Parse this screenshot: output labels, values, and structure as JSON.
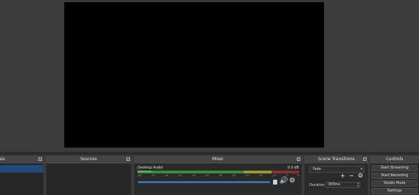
{
  "docks": {
    "scenes": {
      "title": "es"
    },
    "sources": {
      "title": "Sources"
    },
    "mixer": {
      "title": "Mixer",
      "channel": {
        "name": "Desktop Audio",
        "level": "0.0 dB"
      },
      "ticks": [
        "-60",
        "-55",
        "-50",
        "-45",
        "-40",
        "-35",
        "-30",
        "-25",
        "-20",
        "-15",
        "-10",
        "-5",
        "0"
      ]
    },
    "transitions": {
      "title": "Scene Transitions",
      "selected": "Fade",
      "duration_label": "Duration",
      "duration_value": "300ms"
    },
    "controls": {
      "title": "Controls",
      "buttons": [
        "Start Streaming",
        "Start Recording",
        "Studio Mode",
        "Settings"
      ]
    }
  },
  "icons": {
    "float": "float-icon",
    "add": "add-icon",
    "remove": "remove-icon",
    "gear": "gear-icon",
    "speaker": "speaker-icon"
  }
}
